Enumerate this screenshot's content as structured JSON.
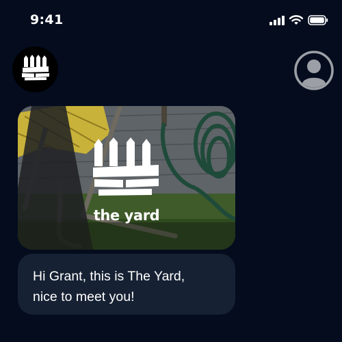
{
  "status_bar": {
    "time": "9:41",
    "icons": [
      "cellular-signal-icon",
      "wifi-icon",
      "battery-icon"
    ]
  },
  "header": {
    "avatar_icon": "the-yard-fence-logo-icon",
    "profile_icon": "user-profile-icon"
  },
  "messages": [
    {
      "type": "image",
      "brand_text": "the yard",
      "logo_icon": "the-yard-fence-logo-icon",
      "scene": "backyard with lawn chair and garden hose"
    },
    {
      "type": "text",
      "lines": [
        "Hi Grant, this is The Yard,",
        "nice to meet you!"
      ]
    }
  ],
  "colors": {
    "background": "#040c1e",
    "bubble": "#162133",
    "text": "#ffffff",
    "icon_gray": "#9ca0a6"
  }
}
